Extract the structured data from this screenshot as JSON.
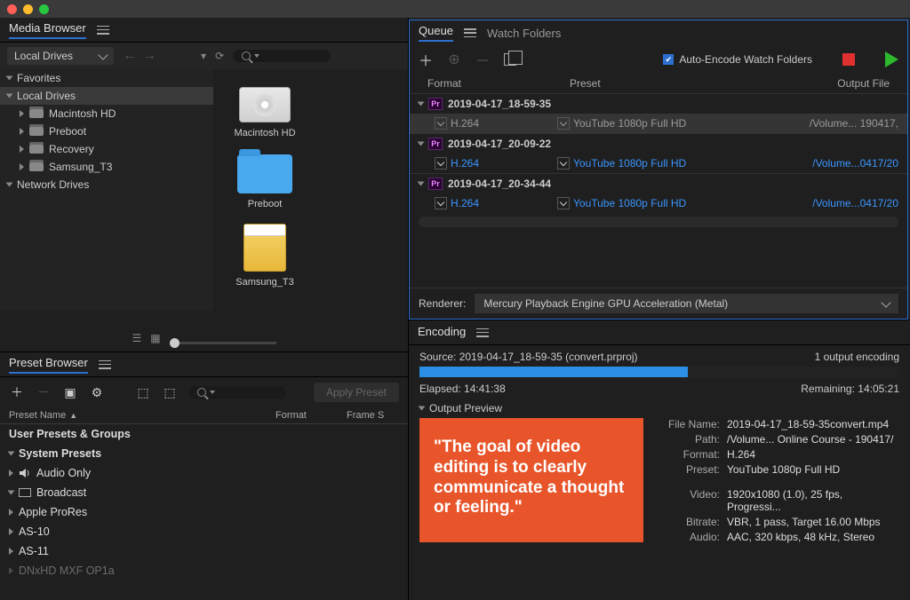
{
  "mediaBrowser": {
    "title": "Media Browser",
    "drivesDropdown": "Local Drives",
    "tree": {
      "favorites": "Favorites",
      "localDrives": "Local Drives",
      "networkDrives": "Network Drives",
      "items": [
        "Macintosh HD",
        "Preboot",
        "Recovery",
        "Samsung_T3"
      ]
    },
    "gridItems": [
      "Macintosh HD",
      "Preboot",
      "Samsung_T3"
    ]
  },
  "presetBrowser": {
    "title": "Preset Browser",
    "applyLabel": "Apply Preset",
    "headers": {
      "name": "Preset Name",
      "format": "Format",
      "frame": "Frame S"
    },
    "groups": {
      "user": "User Presets & Groups",
      "system": "System Presets",
      "audioOnly": "Audio Only",
      "broadcast": "Broadcast"
    },
    "items": [
      "Apple ProRes",
      "AS-10",
      "AS-11",
      "DNxHD MXF OP1a"
    ]
  },
  "queue": {
    "tab": "Queue",
    "watchFolders": "Watch Folders",
    "autoEncode": "Auto-Encode Watch Folders",
    "headers": {
      "format": "Format",
      "preset": "Preset",
      "output": "Output File"
    },
    "jobs": [
      {
        "name": "2019-04-17_18-59-35",
        "format": "H.264",
        "preset": "YouTube 1080p Full HD",
        "output": "/Volume... 190417,",
        "active": false
      },
      {
        "name": "2019-04-17_20-09-22",
        "format": "H.264",
        "preset": "YouTube 1080p Full HD",
        "output": "/Volume...0417/20",
        "active": true
      },
      {
        "name": "2019-04-17_20-34-44",
        "format": "H.264",
        "preset": "YouTube 1080p Full HD",
        "output": "/Volume...0417/20",
        "active": true
      }
    ],
    "rendererLabel": "Renderer:",
    "renderer": "Mercury Playback Engine GPU Acceleration (Metal)"
  },
  "encoding": {
    "title": "Encoding",
    "sourceLabel": "Source:",
    "source": "2019-04-17_18-59-35 (convert.prproj)",
    "outputCount": "1 output encoding",
    "elapsedLabel": "Elapsed:",
    "elapsed": "14:41:38",
    "remainingLabel": "Remaining:",
    "remaining": "14:05:21",
    "outputPreview": "Output Preview",
    "quote": "\"The goal of video editing is to clearly communicate a thought or feeling.\"",
    "meta": {
      "fileNameLabel": "File Name:",
      "fileName": "2019-04-17_18-59-35convert.mp4",
      "pathLabel": "Path:",
      "path": "/Volume... Online Course - 190417/",
      "formatLabel": "Format:",
      "format": "H.264",
      "presetLabel": "Preset:",
      "preset": "YouTube 1080p Full HD",
      "videoLabel": "Video:",
      "video": "1920x1080 (1.0), 25 fps, Progressi...",
      "bitrateLabel": "Bitrate:",
      "bitrate": "VBR, 1 pass, Target 16.00 Mbps",
      "audioLabel": "Audio:",
      "audio": "AAC, 320 kbps, 48 kHz, Stereo"
    }
  }
}
